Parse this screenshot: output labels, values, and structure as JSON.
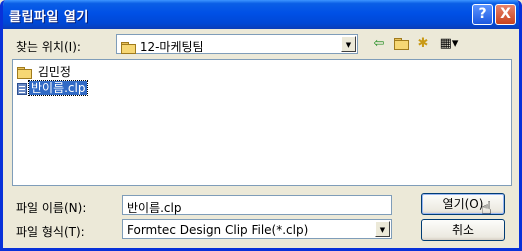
{
  "window": {
    "title": "클립파일 열기",
    "help_glyph": "?",
    "close_glyph": "X"
  },
  "toolbar": {
    "look_in_label": "찾는 위치(I):",
    "look_in_value": "12-마케팅팀",
    "back_icon": "back-arrow-icon",
    "up_icon": "folder-up-icon",
    "new_folder_icon": "new-folder-icon",
    "view_menu_icon": "view-menu-icon"
  },
  "file_list": {
    "items": [
      {
        "name": "김민정",
        "type": "folder",
        "selected": false
      },
      {
        "name": "반이름.clp",
        "type": "file",
        "selected": true
      }
    ]
  },
  "form": {
    "filename_label": "파일 이름(N):",
    "filename_value": "반이름.clp",
    "filetype_label": "파일 형식(T):",
    "filetype_value": "Formtec Design Clip File(*.clp)"
  },
  "buttons": {
    "open_label": "열기(O)",
    "cancel_label": "취소"
  }
}
